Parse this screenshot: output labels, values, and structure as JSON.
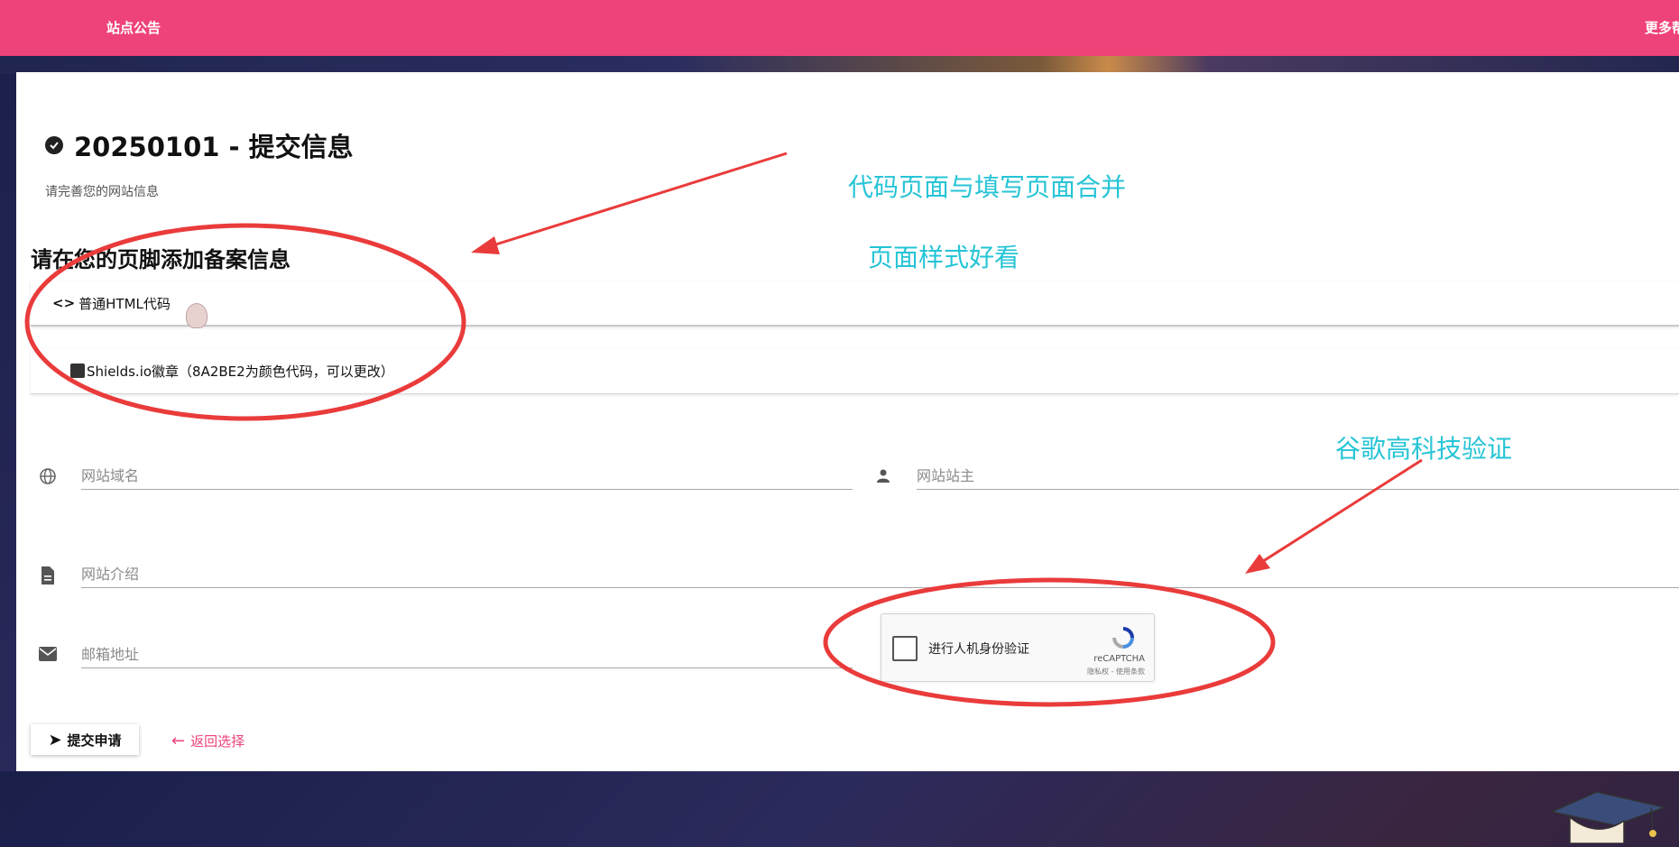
{
  "topbar": {
    "notice": "站点公告",
    "more": "更多帮助"
  },
  "header": {
    "title": "20250101 - 提交信息",
    "subtitle": "请完善您的网站信息"
  },
  "section": {
    "title": "请在您的页脚添加备案信息"
  },
  "code_options": [
    {
      "icon": "code-icon",
      "label": "普通HTML代码"
    },
    {
      "icon": "image-icon",
      "label": "Shields.io徽章（8A2BE2为颜色代码，可以更改）"
    }
  ],
  "form": {
    "domain": {
      "icon": "globe-icon",
      "placeholder": "网站域名"
    },
    "owner": {
      "icon": "person-icon",
      "placeholder": "网站站主"
    },
    "intro": {
      "icon": "document-icon",
      "placeholder": "网站介绍"
    },
    "email": {
      "icon": "mail-icon",
      "placeholder": "邮箱地址"
    }
  },
  "recaptcha": {
    "label": "进行人机身份验证",
    "brand": "reCAPTCHA",
    "terms": "隐私权 - 使用条款"
  },
  "actions": {
    "submit": "提交申请",
    "back": "返回选择"
  },
  "annotations": {
    "merge": "代码页面与填写页面合并",
    "style": "页面样式好看",
    "google": "谷歌高科技验证",
    "color": "#26c4d6",
    "markup_color": "#ea3b3b"
  },
  "colors": {
    "accent": "#ee4379"
  }
}
